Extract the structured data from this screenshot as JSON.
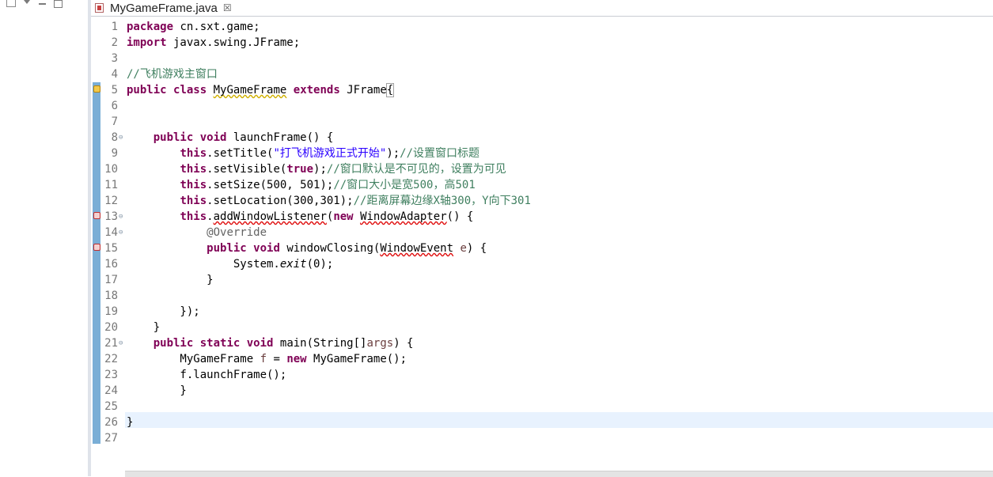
{
  "left_toolbar": {
    "icons": [
      "collapse-all-icon",
      "view-menu-icon",
      "minimize-icon",
      "maximize-icon"
    ]
  },
  "editor_tab": {
    "file_name": "MyGameFrame.java",
    "close_glyph": "☒"
  },
  "colors": {
    "keyword": "#7f0055",
    "comment": "#3f7f5f",
    "string": "#2a00ff",
    "annotation": "#646464",
    "current_line": "#e8f2fe"
  },
  "code_lines": [
    {
      "n": "1",
      "text": "package cn.sxt.game;"
    },
    {
      "n": "2",
      "text": "import javax.swing.JFrame;"
    },
    {
      "n": "3",
      "text": ""
    },
    {
      "n": "4",
      "text": "//飞机游戏主窗口"
    },
    {
      "n": "5",
      "text": "public class MyGameFrame extends JFrame{"
    },
    {
      "n": "6",
      "text": ""
    },
    {
      "n": "7",
      "text": ""
    },
    {
      "n": "8",
      "text": "    public void launchFrame() {"
    },
    {
      "n": "9",
      "text": "        this.setTitle(\"打飞机游戏正式开始\");//设置窗口标题"
    },
    {
      "n": "10",
      "text": "        this.setVisible(true);//窗口默认是不可见的，设置为可见"
    },
    {
      "n": "11",
      "text": "        this.setSize(500, 501);//窗口大小是宽500，高501"
    },
    {
      "n": "12",
      "text": "        this.setLocation(300,301);//距离屏幕边缘X轴300，Y向下301"
    },
    {
      "n": "13",
      "text": "        this.addWindowListener(new WindowAdapter() {"
    },
    {
      "n": "14",
      "text": "            @Override"
    },
    {
      "n": "15",
      "text": "            public void windowClosing(WindowEvent e) {"
    },
    {
      "n": "16",
      "text": "                System.exit(0);"
    },
    {
      "n": "17",
      "text": "            }"
    },
    {
      "n": "18",
      "text": ""
    },
    {
      "n": "19",
      "text": "        });"
    },
    {
      "n": "20",
      "text": "    }"
    },
    {
      "n": "21",
      "text": "    public static void main(String[]args) {"
    },
    {
      "n": "22",
      "text": "        MyGameFrame f = new MyGameFrame();"
    },
    {
      "n": "23",
      "text": "        f.launchFrame();"
    },
    {
      "n": "24",
      "text": "        }"
    },
    {
      "n": "25",
      "text": ""
    },
    {
      "n": "26",
      "text": "}"
    },
    {
      "n": "27",
      "text": ""
    }
  ],
  "folded_lines": [
    "8",
    "13",
    "14",
    "21"
  ],
  "warning_lines": [
    "5"
  ],
  "error_lines": [
    "13",
    "15"
  ],
  "current_line": "26"
}
